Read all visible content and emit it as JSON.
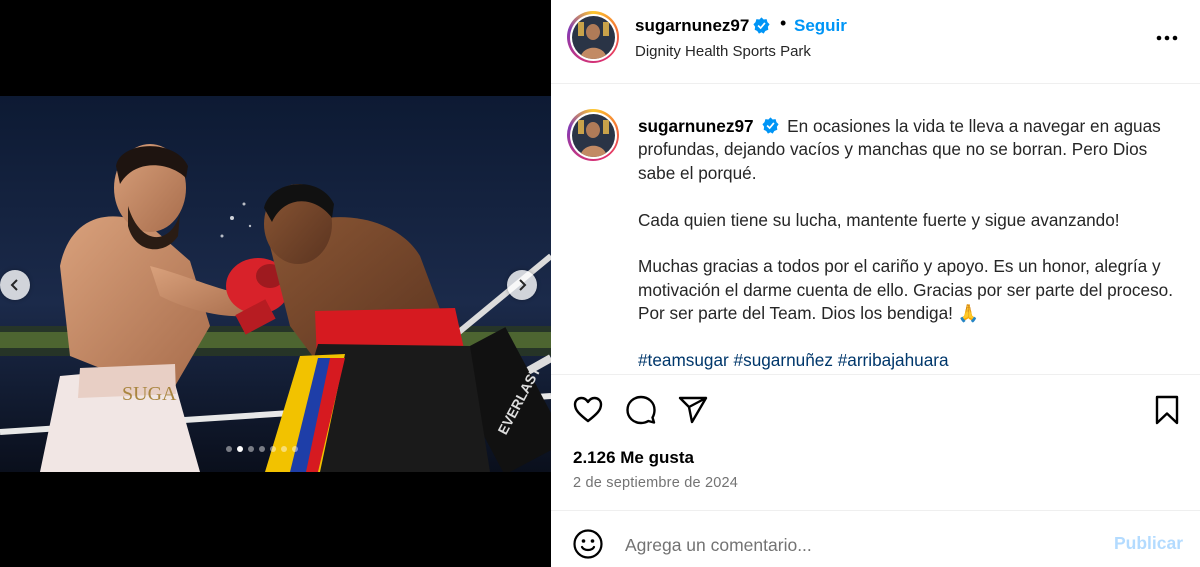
{
  "post": {
    "username": "sugarnunez97",
    "verified": true,
    "follow_label": "Seguir",
    "separator": "•",
    "location": "Dignity Health Sports Park",
    "caption": {
      "username": "sugarnunez97",
      "paragraphs": [
        "En ocasiones la vida te lleva a navegar en aguas profundas, dejando vacíos y manchas que no se borran. Pero Dios sabe el porqué.",
        "Cada quien tiene su lucha, mantente fuerte y sigue avanzando!",
        "Muchas gracias a todos por el cariño y apoyo. Es un honor, alegría y motivación el darme cuenta de ello. Gracias por ser parte del proceso. Por ser parte del Team. Dios los bendiga! 🙏"
      ],
      "hashtags": "#teamsugar #sugarnuñez #arribajahuara"
    },
    "likes": "2.126 Me gusta",
    "date": "2 de septiembre de 2024"
  },
  "media": {
    "trunks_text": "SUGA",
    "corner_text": "EVERLAST",
    "slide_count": 7,
    "active_slide": 2
  },
  "comment_bar": {
    "placeholder": "Agrega un comentario...",
    "publish_label": "Publicar"
  },
  "icons": {
    "like": "heart-icon",
    "comment": "comment-icon",
    "share": "share-icon",
    "save": "bookmark-icon",
    "emoji": "emoji-icon",
    "more": "more-options-icon",
    "verified": "verified-badge-icon"
  },
  "colors": {
    "accent": "#0095f6",
    "hashtag": "#00376b",
    "muted": "#737373",
    "publish_disabled": "#b3dbff"
  }
}
